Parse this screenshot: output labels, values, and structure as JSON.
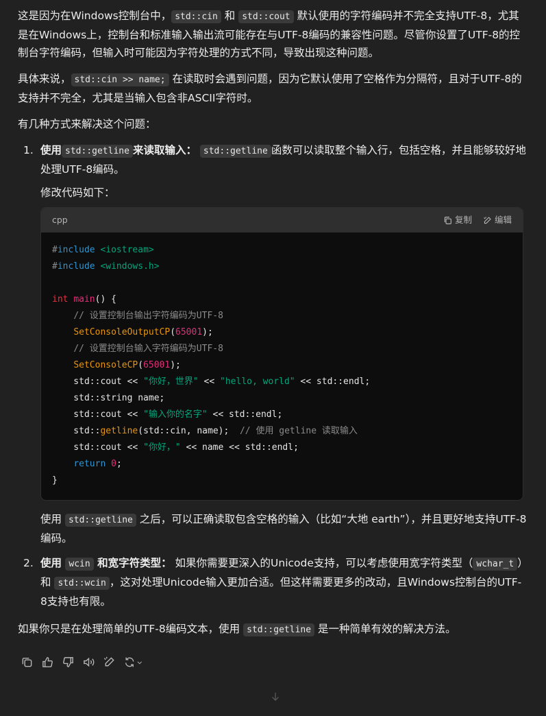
{
  "para1": {
    "t1": "这是因为在Windows控制台中，",
    "c1": "std::cin",
    "t2": " 和 ",
    "c2": "std::cout",
    "t3": " 默认使用的字符编码并不完全支持UTF-8，尤其是在Windows上，控制台和标准输入输出流可能存在与UTF-8编码的兼容性问题。尽管你设置了UTF-8的控制台字符编码，但输入时可能因为字符处理的方式不同，导致出现这种问题。"
  },
  "para2": {
    "t1": "具体来说，",
    "c1": "std::cin >> name;",
    "t2": " 在读取时会遇到问题，因为它默认使用了空格作为分隔符，且对于UTF-8的支持并不完全，尤其是当输入包含非ASCII字符时。"
  },
  "para3": "有几种方式来解决这个问题：",
  "item1": {
    "num": "1.",
    "b1": "使用",
    "c1": "std::getline",
    "b2": "来读取输入：",
    "c2": "std::getline",
    "t1": "函数可以读取整个输入行，包括空格，并且能够较好地处理UTF-8编码。",
    "sub": "修改代码如下：",
    "code": {
      "lang": "cpp",
      "copy": "复制",
      "edit": "编辑"
    },
    "after": {
      "t1": "使用 ",
      "c1": "std::getline",
      "t2": " 之后，可以正确读取包含空格的输入（比如“大地 earth”），并且更好地支持UTF-8编码。"
    }
  },
  "item2": {
    "num": "2.",
    "b1": "使用 ",
    "c1": "wcin",
    "b2": " 和宽字符类型：",
    "t1": " 如果你需要更深入的Unicode支持，可以考虑使用宽字符类型（",
    "c2": "wchar_t",
    "t2": "）和 ",
    "c3": "std::wcin",
    "t3": "，这对处理Unicode输入更加合适。但这样需要更多的改动，且Windows控制台的UTF-8支持也有限。"
  },
  "final": {
    "t1": "如果你只是在处理简单的UTF-8编码文本，使用 ",
    "c1": "std::getline",
    "t2": " 是一种简单有效的解决方法。"
  },
  "icons": [
    "copy-icon",
    "thumbs-up-icon",
    "thumbs-down-icon",
    "speaker-icon",
    "edit-icon",
    "regenerate-icon",
    "chevron-down-icon",
    "arrow-down-icon"
  ]
}
